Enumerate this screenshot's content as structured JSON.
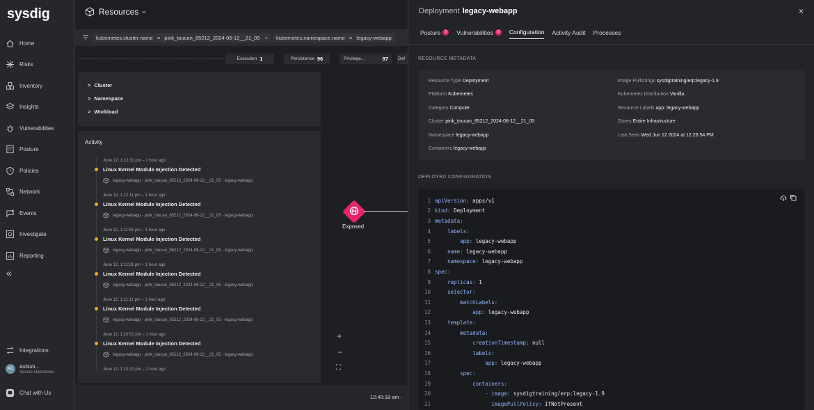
{
  "brand": {
    "logo": "sysdig"
  },
  "nav": {
    "items": [
      {
        "label": "Home",
        "icon": "home-icon"
      },
      {
        "label": "Risks",
        "icon": "risks-icon"
      },
      {
        "label": "Inventory",
        "icon": "inventory-icon"
      },
      {
        "label": "Insights",
        "icon": "insights-icon"
      },
      {
        "label": "Vulnerabilities",
        "icon": "vulnerabilities-icon"
      },
      {
        "label": "Posture",
        "icon": "posture-icon"
      },
      {
        "label": "Policies",
        "icon": "policies-icon"
      },
      {
        "label": "Network",
        "icon": "network-icon"
      },
      {
        "label": "Events",
        "icon": "events-icon"
      },
      {
        "label": "Investigate",
        "icon": "investigate-icon"
      },
      {
        "label": "Reporting",
        "icon": "reporting-icon"
      }
    ],
    "collapse_glyph": "«",
    "integrations": "Integrations",
    "user": {
      "initials": "AC",
      "name": "Ashish...",
      "role": "Secure Operations"
    },
    "chat": "Chat with Us"
  },
  "resources": {
    "title": "Resources",
    "filters": {
      "f1_key": "kubernetes.cluster.name",
      "f1_op": "=",
      "f1_val": "pink_toucan_85212_2024-06-12__21_05",
      "f1_close": "×",
      "f2_key": "kubernetes.namespace.name",
      "f2_op": "=",
      "f2_val": "legacy-webapp"
    },
    "stats": [
      {
        "label": "Execution",
        "value": "1"
      },
      {
        "label": "Persistence",
        "value": "96"
      },
      {
        "label": "Privilege...",
        "value": "97"
      },
      {
        "label": "Def",
        "value": ""
      }
    ],
    "tree": [
      "Cluster",
      "Namespace",
      "Workload"
    ],
    "tree_chevron": ">",
    "activity": {
      "title": "Activity",
      "events": [
        {
          "time": "June 12, 1:12:31 pm – 1 hour ago",
          "title": "Linux Kernel Module Injection Detected",
          "source": "legacy-webapp - pink_toucan_85212_2024-06-12__21_05 - legacy-webapp"
        },
        {
          "time": "June 12, 1:12:11 pm – 1 hour ago",
          "title": "Linux Kernel Module Injection Detected",
          "source": "legacy-webapp - pink_toucan_85212_2024-06-12__21_05 - legacy-webapp"
        },
        {
          "time": "June 12, 1:11:51 pm – 1 hour ago",
          "title": "Linux Kernel Module Injection Detected",
          "source": "legacy-webapp - pink_toucan_85212_2024-06-12__21_05 - legacy-webapp"
        },
        {
          "time": "June 12, 1:11:31 pm – 1 hour ago",
          "title": "Linux Kernel Module Injection Detected",
          "source": "legacy-webapp - pink_toucan_85212_2024-06-12__21_05 - legacy-webapp"
        },
        {
          "time": "June 12, 1:11:11 pm – 1 hour ago",
          "title": "Linux Kernel Module Injection Detected",
          "source": "legacy-webapp - pink_toucan_85212_2024-06-12__21_05 - legacy-webapp"
        },
        {
          "time": "June 12, 1:10:51 pm – 1 hour ago",
          "title": "Linux Kernel Module Injection Detected",
          "source": "legacy-webapp - pink_toucan_85212_2024-06-12__21_05 - legacy-webapp"
        }
      ],
      "last_time": "June 12, 1:10:31 pm – 1 hour ago"
    },
    "graph": {
      "node_label": "Exposed",
      "zoom_in": "+",
      "zoom_out": "−",
      "fit": "⛶"
    },
    "time": "12:40:18 am -"
  },
  "panel": {
    "type_label": "Deployment",
    "name": "legacy-webapp",
    "close": "×",
    "tabs": [
      {
        "label": "Posture",
        "badge": "5"
      },
      {
        "label": "Vulnerabilities",
        "badge": "8"
      },
      {
        "label": "Configuration",
        "badge": ""
      },
      {
        "label": "Activity Audit",
        "badge": ""
      },
      {
        "label": "Processes",
        "badge": ""
      }
    ],
    "metadata_title": "RESOURCE METADATA",
    "metadata": {
      "left": [
        {
          "k": "Resource Type",
          "v": "Deployment"
        },
        {
          "k": "Platform",
          "v": "Kubernetes"
        },
        {
          "k": "Category",
          "v": "Compute"
        },
        {
          "k": "Cluster",
          "v": "pink_toucan_85212_2024-06-12__21_05"
        },
        {
          "k": "Namespace",
          "v": "legacy-webapp"
        },
        {
          "k": "Containers",
          "v": "legacy-webapp"
        }
      ],
      "right": [
        {
          "k": "Image Pullstrings",
          "v": "sysdigtraining/erp:legacy-1.9"
        },
        {
          "k": "Kubernetes Distribution",
          "v": "Vanilla"
        },
        {
          "k": "Resource Labels",
          "v": "app: legacy-webapp"
        },
        {
          "k": "Zones",
          "v": "Entire Infrastructure"
        },
        {
          "k": "Last Seen",
          "v": "Wed Jun 12 2024 at 12:26:54 PM"
        }
      ]
    },
    "config_title": "DEPLOYED CONFIGURATION",
    "code": [
      {
        "n": "1",
        "indent": "",
        "key": "apiVersion",
        "val": " apps/v1"
      },
      {
        "n": "2",
        "indent": "",
        "key": "kind",
        "val": " Deployment"
      },
      {
        "n": "3",
        "indent": "",
        "key": "metadata",
        "val": ""
      },
      {
        "n": "4",
        "indent": "    ",
        "key": "labels",
        "val": ""
      },
      {
        "n": "5",
        "indent": "        ",
        "key": "app",
        "val": " legacy-webapp"
      },
      {
        "n": "6",
        "indent": "    ",
        "key": "name",
        "val": " legacy-webapp"
      },
      {
        "n": "7",
        "indent": "    ",
        "key": "namespace",
        "val": " legacy-webapp"
      },
      {
        "n": "8",
        "indent": "",
        "key": "spec",
        "val": ""
      },
      {
        "n": "9",
        "indent": "    ",
        "key": "replicas",
        "val": " 1"
      },
      {
        "n": "10",
        "indent": "    ",
        "key": "selector",
        "val": ""
      },
      {
        "n": "11",
        "indent": "        ",
        "key": "matchLabels",
        "val": ""
      },
      {
        "n": "12",
        "indent": "            ",
        "key": "app",
        "val": " legacy-webapp"
      },
      {
        "n": "13",
        "indent": "    ",
        "key": "template",
        "val": ""
      },
      {
        "n": "14",
        "indent": "        ",
        "key": "metadata",
        "val": ""
      },
      {
        "n": "15",
        "indent": "            ",
        "key": "creationTimestamp",
        "val": " null"
      },
      {
        "n": "16",
        "indent": "            ",
        "key": "labels",
        "val": ""
      },
      {
        "n": "17",
        "indent": "                ",
        "key": "app",
        "val": " legacy-webapp"
      },
      {
        "n": "18",
        "indent": "        ",
        "key": "spec",
        "val": ""
      },
      {
        "n": "19",
        "indent": "            ",
        "key": "containers",
        "val": ""
      },
      {
        "n": "20",
        "indent": "                ",
        "key": "- image",
        "val": " sysdigtraining/erp:legacy-1.9"
      },
      {
        "n": "21",
        "indent": "                  ",
        "key": "imagePullPolicy",
        "val": " IfNotPresent"
      }
    ]
  },
  "colors": {
    "accent": "#e6246f",
    "event_dot": "#f5a623",
    "yaml_key": "#8fb4ff"
  }
}
